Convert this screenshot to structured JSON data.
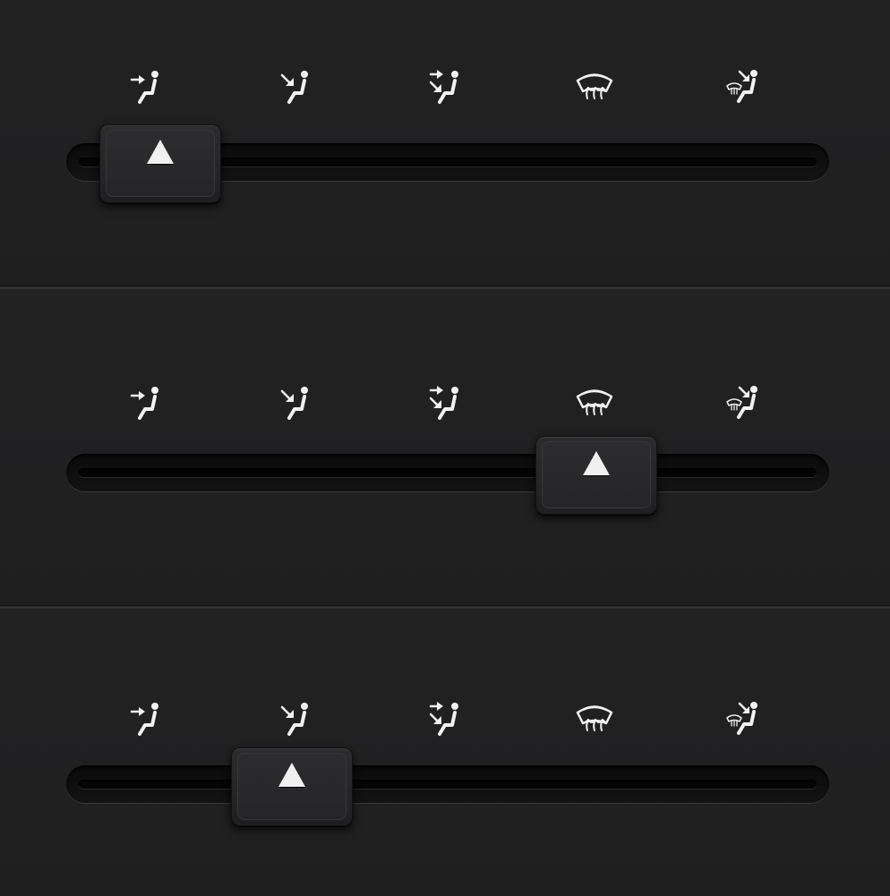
{
  "colors": {
    "background": "#232324",
    "icon": "#f2f2f2",
    "track": "#0b0b0b",
    "knob": "#2a2a2c"
  },
  "modes": [
    {
      "id": "face",
      "icon": "face-vent-icon"
    },
    {
      "id": "face-feet",
      "icon": "face-feet-vent-icon"
    },
    {
      "id": "feet",
      "icon": "feet-vent-icon"
    },
    {
      "id": "defrost",
      "icon": "windshield-defrost-icon"
    },
    {
      "id": "defrost-feet",
      "icon": "defrost-feet-vent-icon"
    }
  ],
  "sliders": [
    {
      "selected_mode": "face",
      "selected_index": 0
    },
    {
      "selected_mode": "defrost",
      "selected_index": 3
    },
    {
      "selected_mode": "face-feet",
      "selected_index": 1
    }
  ]
}
